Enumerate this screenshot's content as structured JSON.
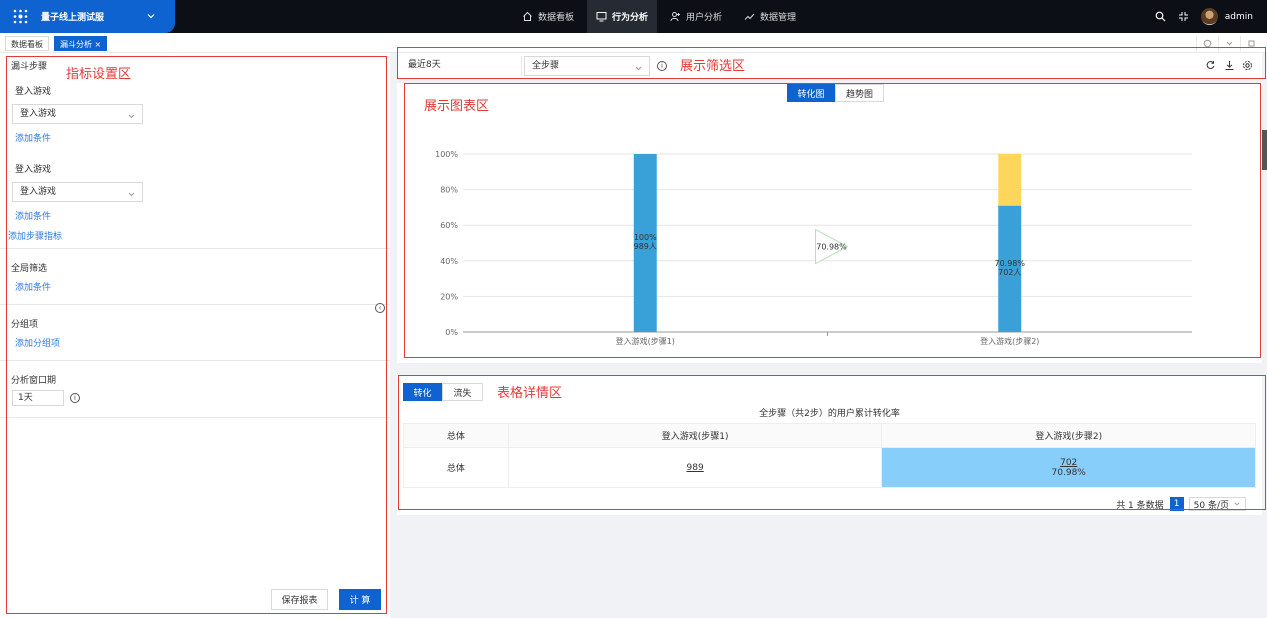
{
  "topbar": {
    "app_title": "量子线上测试服",
    "nav": [
      {
        "label": "数据看板",
        "icon": "home-icon",
        "active": false
      },
      {
        "label": "行为分析",
        "icon": "monitor-icon",
        "active": true
      },
      {
        "label": "用户分析",
        "icon": "user-icon",
        "active": false
      },
      {
        "label": "数据管理",
        "icon": "trend-icon",
        "active": false
      }
    ],
    "username": "admin"
  },
  "tabs": [
    {
      "label": "数据看板",
      "active": false
    },
    {
      "label": "漏斗分析 ×",
      "active": true
    }
  ],
  "left": {
    "funnel_title": "漏斗步骤",
    "steps": [
      {
        "name": "登入游戏",
        "select_value": "登入游戏",
        "add_condition": "添加条件"
      },
      {
        "name": "登入游戏",
        "select_value": "登入游戏",
        "add_condition": "添加条件"
      }
    ],
    "add_step_metric": "添加步骤指标",
    "global_filter": "全局筛选",
    "global_add_condition": "添加条件",
    "group_title": "分组项",
    "add_group": "添加分组项",
    "window_title": "分析窗口期",
    "window_value": "1天",
    "save_button": "保存报表",
    "compute_button": "计 算"
  },
  "filter": {
    "date_range": "最近8天",
    "step_select": "全步骤"
  },
  "chart_tabs": [
    {
      "label": "转化图",
      "active": true
    },
    {
      "label": "趋势图",
      "active": false
    }
  ],
  "chart_data": {
    "type": "bar",
    "categories": [
      "登入游戏(步骤1)",
      "登入游戏(步骤2)"
    ],
    "series": [
      {
        "values": [
          100,
          70.98
        ],
        "color": "#3aa1d8"
      },
      {
        "values": [
          0,
          29.02
        ],
        "color": "#ffd65c"
      }
    ],
    "bar_labels": [
      {
        "pct": "100%",
        "count": "989人"
      },
      {
        "pct": "70.98%",
        "count": "702人"
      }
    ],
    "conversion_label": "70.98%",
    "yticks": [
      "0%",
      "20%",
      "40%",
      "60%",
      "80%",
      "100%"
    ],
    "ylim": [
      0,
      100
    ],
    "grid": true
  },
  "table_tabs": [
    {
      "label": "转化",
      "active": true
    },
    {
      "label": "流失",
      "active": false
    }
  ],
  "table": {
    "caption": "全步骤（共2步）的用户累计转化率",
    "headers": [
      "总体",
      "登入游戏(步骤1)",
      "登入游戏(步骤2)"
    ],
    "row": {
      "label": "总体",
      "step1": "989",
      "step2_count": "702",
      "step2_rate": "70.98%"
    }
  },
  "pager": {
    "total": "共 1 条数据",
    "page": "1",
    "page_size": "50 条/页"
  },
  "annotations": {
    "metric_area": "指标设置区",
    "filter_area": "展示筛选区",
    "chart_area": "展示图表区",
    "table_area": "表格详情区"
  }
}
